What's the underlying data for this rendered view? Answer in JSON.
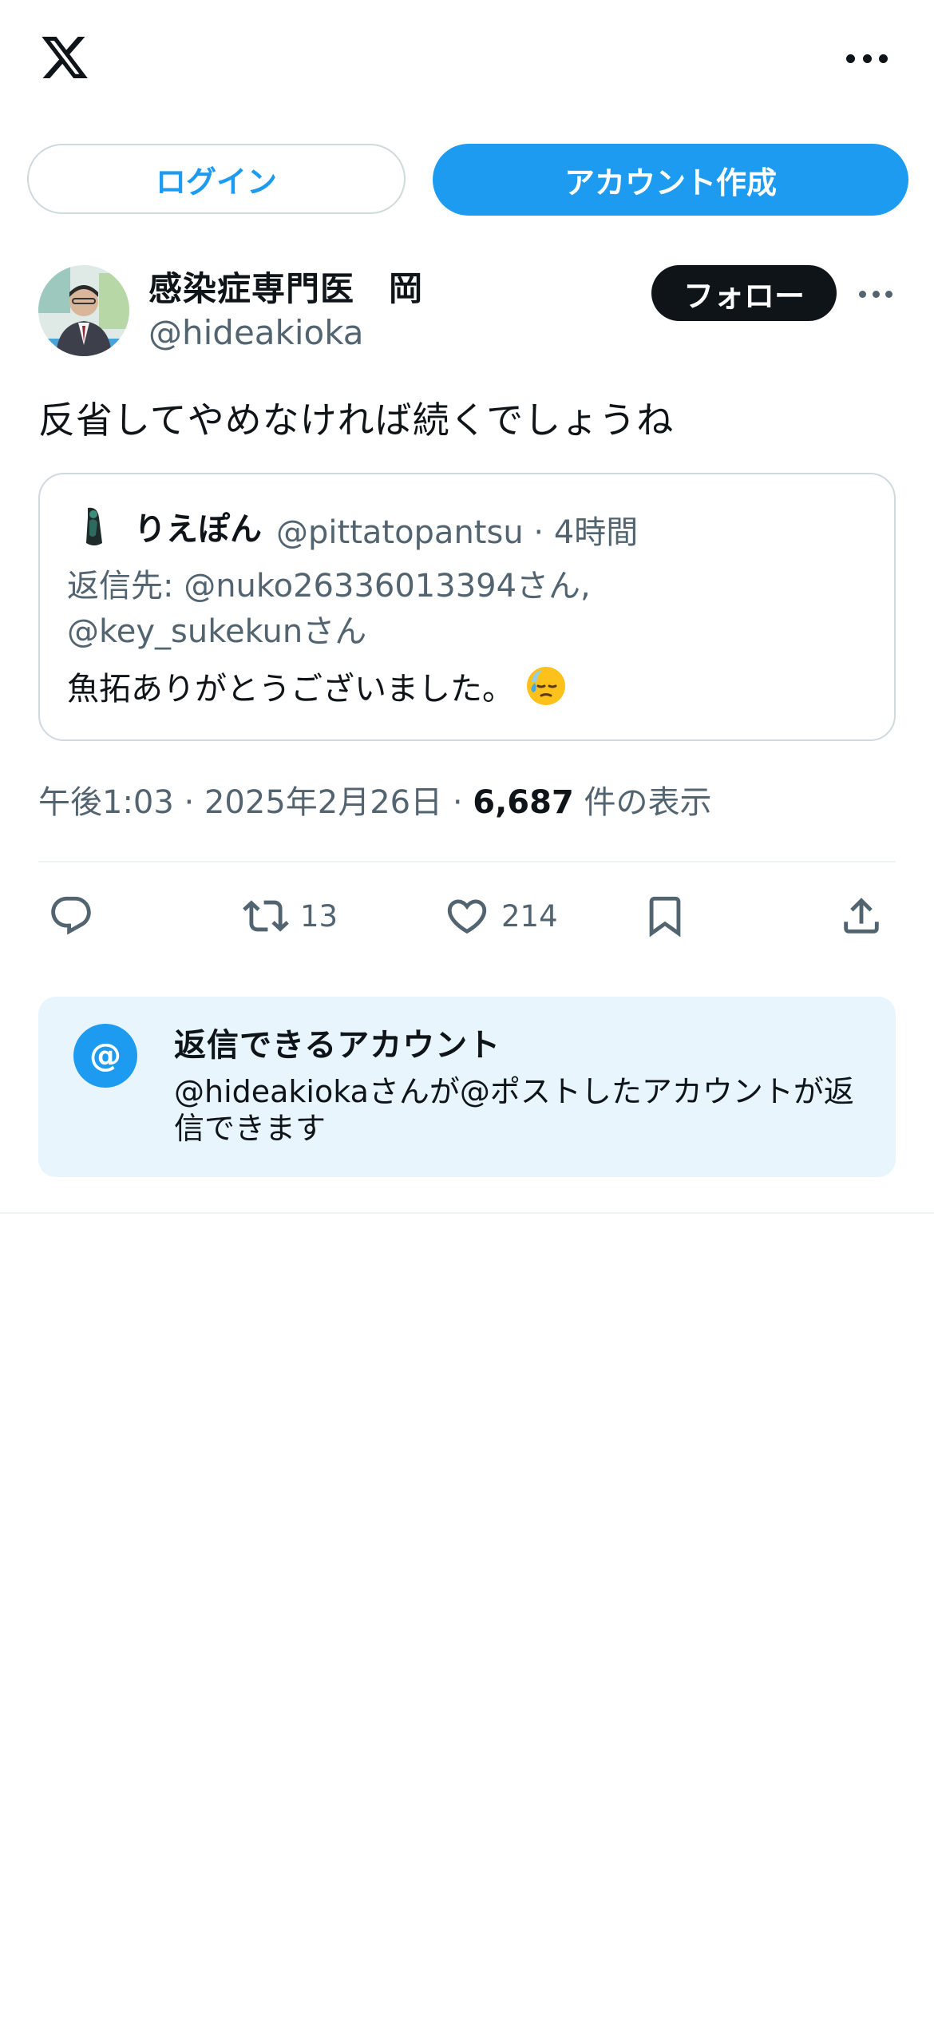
{
  "topbar": {
    "logo": "x-logo",
    "more": "more-icon"
  },
  "auth": {
    "login_label": "ログイン",
    "signup_label": "アカウント作成"
  },
  "post": {
    "author_name": "感染症専門医　岡",
    "author_handle": "@hideakioka",
    "follow_label": "フォロー",
    "text": "反省してやめなければ続くでしょうね",
    "timestamp": "午後1:03 · 2025年2月26日 · ",
    "views": "6,687",
    "views_suffix": " 件の表示"
  },
  "quote": {
    "name": "りえぽん",
    "handle_time": "@pittatopantsu · 4時間",
    "reply_to": "返信先: @nuko26336013394さん, @key_sukekunさん",
    "text": "魚拓ありがとうございました。",
    "emoji": "downcast-face-with-sweat"
  },
  "actions": {
    "reply_count": "",
    "retweet_count": "13",
    "like_count": "214"
  },
  "restriction": {
    "title": "返信できるアカウント",
    "desc": "@hideakiokaさんが@ポストしたアカウントが返信できます"
  },
  "colors": {
    "accent": "#1d9bf0",
    "text": "#0f1419",
    "secondary": "#536471",
    "restrict_bg": "#e8f5fd"
  }
}
